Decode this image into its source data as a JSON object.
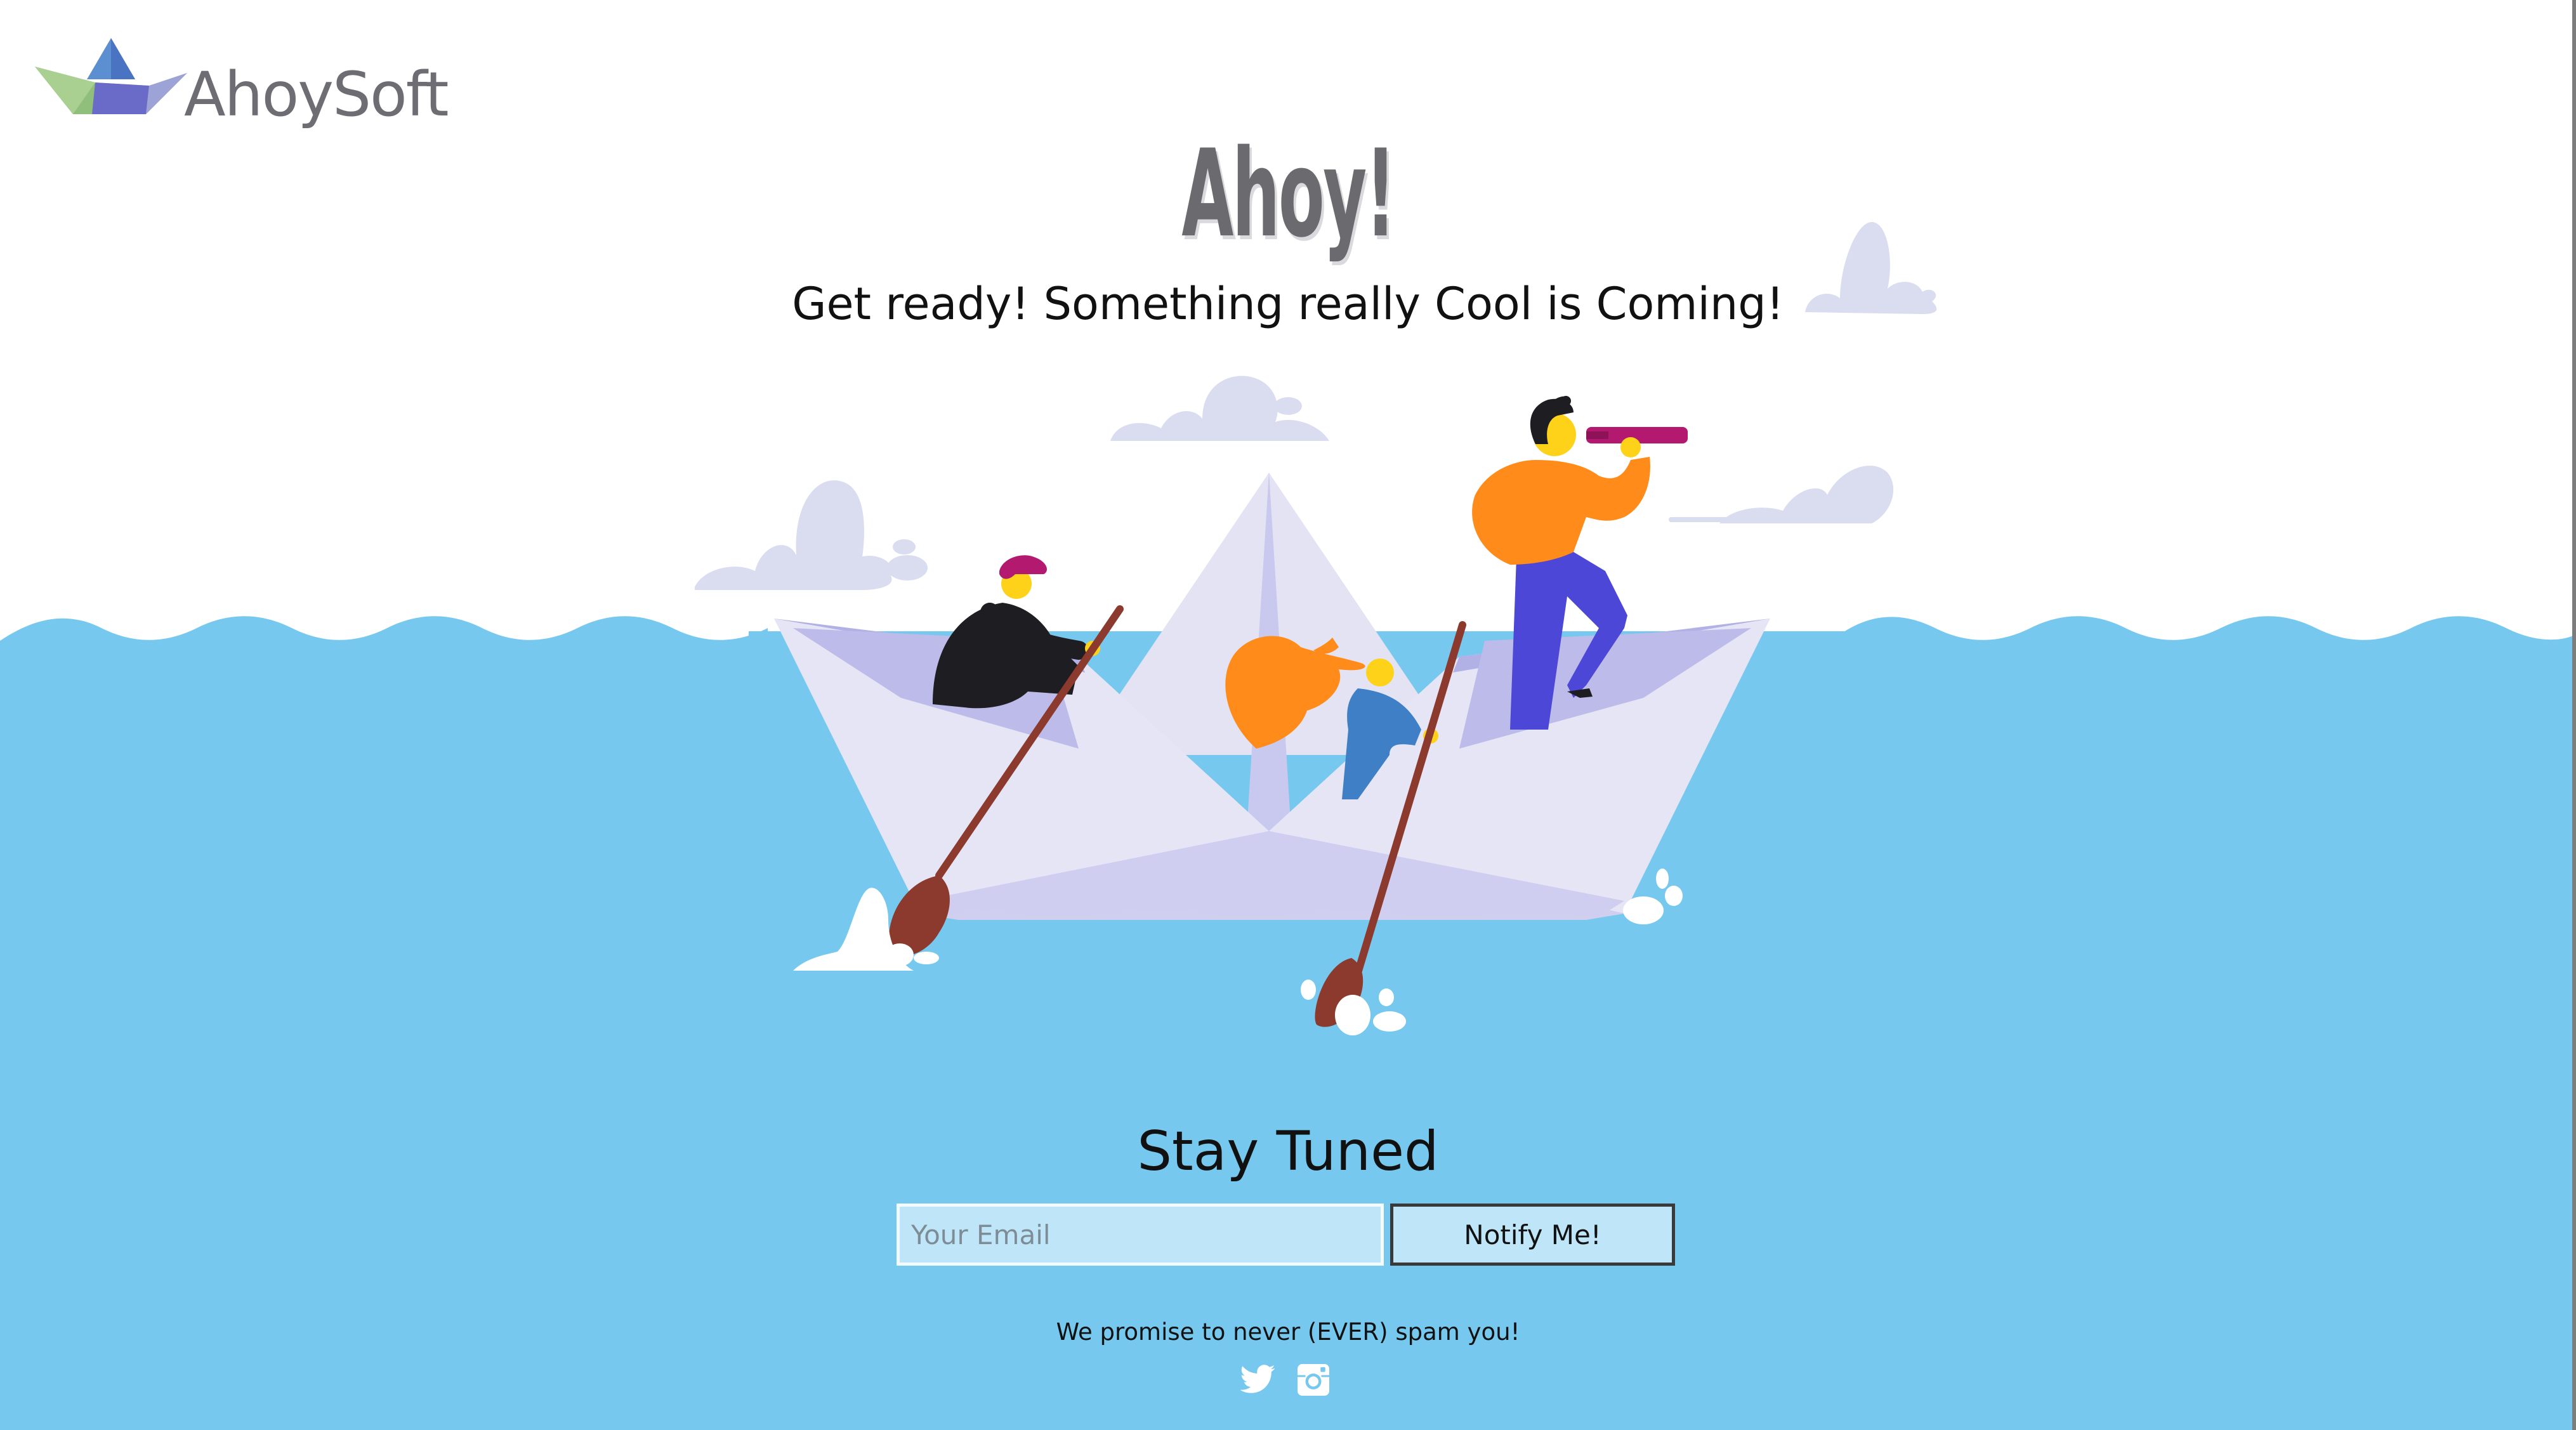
{
  "brand": {
    "name": "AhoySoft"
  },
  "hero": {
    "headline": "Ahoy!",
    "subtitle": "Get ready! Something really Cool is Coming!"
  },
  "signup": {
    "heading": "Stay Tuned",
    "email_placeholder": "Your Email",
    "email_value": "",
    "button_label": "Notify Me!",
    "promise": "We promise to never (EVER) spam you!"
  },
  "social": [
    {
      "icon": "twitter-icon"
    },
    {
      "icon": "instagram-icon"
    }
  ],
  "colors": {
    "sea": "#76c8ee",
    "cloud": "#dadcf0",
    "boat_light": "#e6e6f4",
    "boat_shade": "#b2b1e6",
    "oar": "#8b3a2d",
    "accent_orange": "#ff8c1a",
    "accent_purple": "#4c47d6"
  }
}
